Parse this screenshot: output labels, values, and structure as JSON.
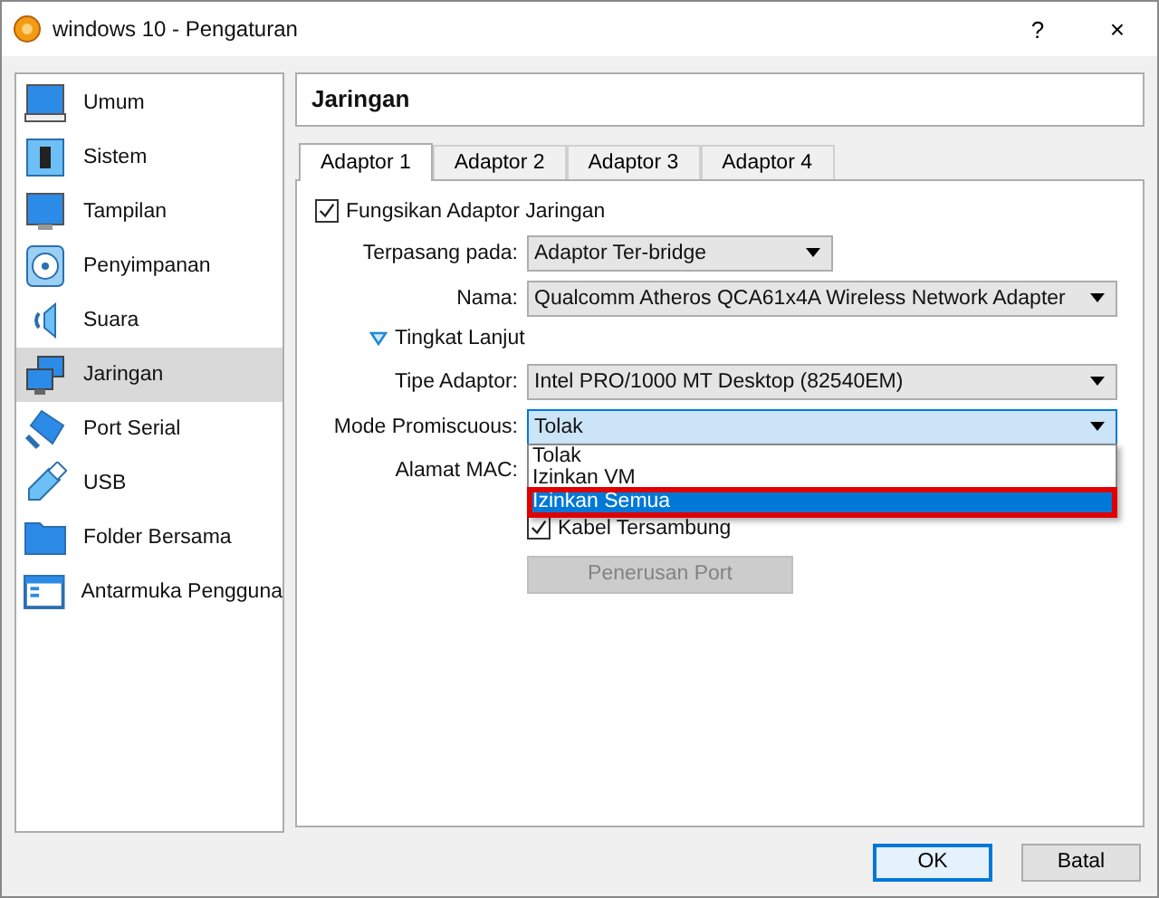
{
  "window": {
    "title": "windows 10 - Pengaturan",
    "help": "?",
    "close": "×"
  },
  "sidebar": {
    "items": [
      {
        "label": "Umum",
        "selected": false
      },
      {
        "label": "Sistem",
        "selected": false
      },
      {
        "label": "Tampilan",
        "selected": false
      },
      {
        "label": "Penyimpanan",
        "selected": false
      },
      {
        "label": "Suara",
        "selected": false
      },
      {
        "label": "Jaringan",
        "selected": true
      },
      {
        "label": "Port Serial",
        "selected": false
      },
      {
        "label": "USB",
        "selected": false
      },
      {
        "label": "Folder Bersama",
        "selected": false
      },
      {
        "label": "Antarmuka Pengguna",
        "selected": false
      }
    ]
  },
  "page_title": "Jaringan",
  "tabs": [
    {
      "label": "Adaptor 1",
      "selected": true
    },
    {
      "label": "Adaptor 2",
      "selected": false
    },
    {
      "label": "Adaptor 3",
      "selected": false
    },
    {
      "label": "Adaptor 4",
      "selected": false
    }
  ],
  "form": {
    "enable_adapter": {
      "label": "Fungsikan Adaptor Jaringan",
      "checked": true
    },
    "attached_to": {
      "label": "Terpasang pada:",
      "value": "Adaptor Ter-bridge"
    },
    "name": {
      "label": "Nama:",
      "value": "Qualcomm Atheros QCA61x4A Wireless Network Adapter"
    },
    "advanced": {
      "label": "Tingkat Lanjut",
      "expanded": true
    },
    "adapter_type": {
      "label": "Tipe Adaptor:",
      "value": "Intel PRO/1000 MT Desktop (82540EM)"
    },
    "promiscuous": {
      "label": "Mode Promiscuous:",
      "value": "Tolak",
      "open": true,
      "options": [
        {
          "label": "Tolak",
          "hovered": false,
          "highlighted": false
        },
        {
          "label": "Izinkan VM",
          "hovered": false,
          "highlighted": false
        },
        {
          "label": "Izinkan Semua",
          "hovered": true,
          "highlighted": true
        }
      ]
    },
    "mac": {
      "label": "Alamat MAC:"
    },
    "cable": {
      "label": "Kabel Tersambung",
      "checked": true
    },
    "port_forwarding": {
      "label": "Penerusan Port",
      "disabled": true
    }
  },
  "buttons": [
    {
      "label": "OK",
      "default": true
    },
    {
      "label": "Batal",
      "default": false
    }
  ]
}
